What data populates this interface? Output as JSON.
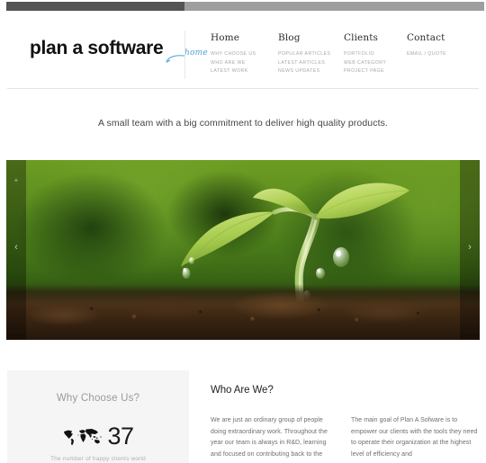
{
  "window": {
    "scrollbar_fill_pct": 37
  },
  "header": {
    "logo": "plan a software",
    "home_marker": "home",
    "nav": [
      {
        "label": "Home",
        "items": [
          "WHY CHOOSE US",
          "WHO ARE WE",
          "LATEST WORK"
        ]
      },
      {
        "label": "Blog",
        "items": [
          "POPULAR ARTICLES",
          "LATEST ARTICLES",
          "NEWS UPDATES"
        ]
      },
      {
        "label": "Clients",
        "items": [
          "PORTFOLIO",
          "WEB CATEGORY",
          "PROJECT PAGE"
        ]
      },
      {
        "label": "Contact",
        "items": [
          "EMAIL / QUOTE"
        ]
      }
    ]
  },
  "tagline": "A small team with a big commitment to deliver high quality products.",
  "hero": {
    "alt": "green seedling sprouting from dark soil with water droplets",
    "prev_arrow": "‹",
    "next_arrow": "›",
    "plus_marker": "+"
  },
  "sections": {
    "why_choose_us": {
      "title": "Why Choose Us?",
      "icon": "world-map-icon",
      "number": "37",
      "caption": "The number of happy clients world"
    },
    "who_are_we": {
      "title": "Who Are We?",
      "body": "We are just an ordinary group of people doing extraordinary work. Throughout the year our team is always in R&D, learning and focused on contributing back to the"
    },
    "main_goal": {
      "body": "The main goal of Plan A Sofware is to empower our clients with the tools they need to operate their organization at the highest level of efficiency and"
    }
  },
  "colors": {
    "accent_blue": "#4aa3d8",
    "panel_gray": "#f5f5f5",
    "text_dark": "#222222",
    "text_muted": "#6e6e6e"
  }
}
